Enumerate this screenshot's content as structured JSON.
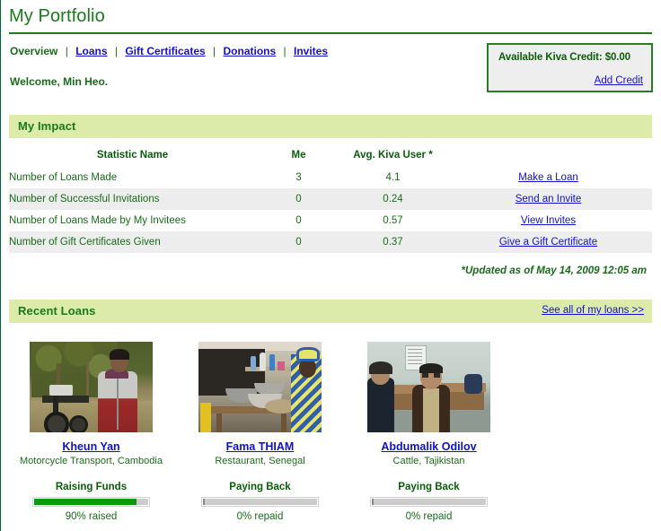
{
  "header": {
    "title": "My Portfolio",
    "welcome": "Welcome, Min Heo.",
    "nav": [
      {
        "label": "Overview",
        "current": true
      },
      {
        "label": "Loans",
        "current": false
      },
      {
        "label": "Gift Certificates",
        "current": false
      },
      {
        "label": "Donations",
        "current": false
      },
      {
        "label": "Invites",
        "current": false
      }
    ],
    "nav_separator": "|"
  },
  "credit_box": {
    "label": "Available Kiva Credit: $0.00",
    "add_link": "Add Credit"
  },
  "impact": {
    "section_title": "My Impact",
    "columns": [
      "Statistic Name",
      "Me",
      "Avg. Kiva User *",
      ""
    ],
    "rows": [
      {
        "name": "Number of Loans Made",
        "me": "3",
        "avg": "4.1",
        "action": "Make a Loan"
      },
      {
        "name": "Number of Successful Invitations",
        "me": "0",
        "avg": "0.24",
        "action": "Send an Invite"
      },
      {
        "name": "Number of Loans Made by My Invitees",
        "me": "0",
        "avg": "0.57",
        "action": "View Invites"
      },
      {
        "name": "Number of Gift Certificates Given",
        "me": "0",
        "avg": "0.37",
        "action": "Give a Gift Certificate"
      }
    ],
    "updated_note": "*Updated as of May 14, 2009 12:05 am"
  },
  "recent_loans": {
    "section_title": "Recent Loans",
    "see_all_link": "See all of my loans >>",
    "cards": [
      {
        "name": "Kheun Yan",
        "description": "Motorcycle Transport, Cambodia",
        "status": "Raising Funds",
        "progress_label": "90% raised",
        "progress_percent": 90,
        "bar_color": "#0a9a0a"
      },
      {
        "name": "Fama THIAM",
        "description": "Restaurant, Senegal",
        "status": "Paying Back",
        "progress_label": "0% repaid",
        "progress_percent": 0,
        "bar_color": "#0a9a0a"
      },
      {
        "name": "Abdumalik Odilov",
        "description": "Cattle, Tajikistan",
        "status": "Paying Back",
        "progress_label": "0% repaid",
        "progress_percent": 0,
        "bar_color": "#0a9a0a"
      }
    ]
  },
  "colors": {
    "band_background": "#dcebaa",
    "heading_green": "#1a7a1a",
    "link_blue": "#1111cc",
    "text_green": "#1a6b1a",
    "row_alt": "#ededed",
    "credit_box_bg": "#eeeeee",
    "credit_box_border": "#2a7a2a"
  }
}
